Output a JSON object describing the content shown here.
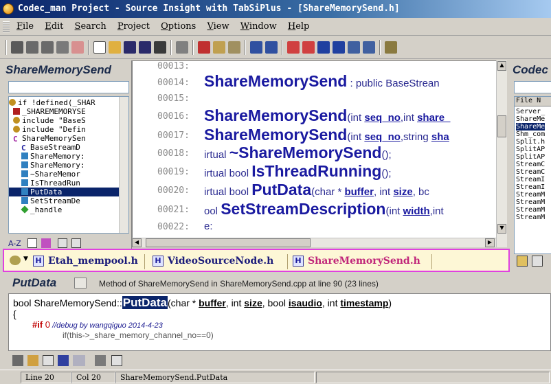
{
  "window": {
    "title": "Codec_man Project - Source Insight with TabSiPlus - [ShareMemorySend.h]"
  },
  "menu": {
    "items": [
      "File",
      "Edit",
      "Search",
      "Project",
      "Options",
      "View",
      "Window",
      "Help"
    ]
  },
  "symbol_panel": {
    "title": "ShareMemorySend",
    "symbols": [
      {
        "label": "if !defined(_SHAR",
        "icon": "preprocessor-icon"
      },
      {
        "label": "_SHAREMEMORYSE",
        "icon": "define-icon"
      },
      {
        "label": "include \"BaseS",
        "icon": "include-icon"
      },
      {
        "label": "include \"Defin",
        "icon": "include-icon"
      },
      {
        "label": "ShareMemorySen",
        "icon": "class-icon"
      },
      {
        "label": "BaseStreamD",
        "icon": "class-icon"
      },
      {
        "label": "ShareMemory:",
        "icon": "method-icon"
      },
      {
        "label": "ShareMemory:",
        "icon": "method-icon"
      },
      {
        "label": "~ShareMemor",
        "icon": "method-icon"
      },
      {
        "label": "IsThreadRun",
        "icon": "method-icon"
      },
      {
        "label": "PutData",
        "icon": "method-icon",
        "selected": true
      },
      {
        "label": "SetStreamDe",
        "icon": "method-icon"
      },
      {
        "label": "_handle",
        "icon": "member-icon"
      }
    ],
    "bottom_label": "A-Z"
  },
  "editor": {
    "line_numbers": [
      "00013:",
      "00014:",
      "00015:",
      "00016:",
      "00017:",
      "00018:",
      "00019:",
      "00020:",
      "00021:",
      "00022:"
    ],
    "lines": {
      "l14_name": "ShareMemorySend",
      "l14_rest": " : public BaseStrean",
      "l16_name": "ShareMemorySend",
      "l16_p1": "(int ",
      "l16_a1": "seq_no",
      "l16_p2": ",int ",
      "l16_a2": "share_",
      "l17_name": "ShareMemorySend",
      "l17_p1": "(int ",
      "l17_a1": "seq_no",
      "l17_p2": ",string ",
      "l17_a2": "sha",
      "l18_pre": "irtual ",
      "l18_name": "~ShareMemorySend",
      "l18_post": "();",
      "l19_pre": "irtual bool ",
      "l19_name": "IsThreadRunning",
      "l19_post": "();",
      "l20_pre": "irtual bool ",
      "l20_name": "PutData",
      "l20_p1": "(char * ",
      "l20_a1": "buffer",
      "l20_p2": ", int ",
      "l20_a2": "size",
      "l20_p3": ", bc",
      "l21_pre": "ool ",
      "l21_name": "SetStreamDescription",
      "l21_p1": "(int ",
      "l21_a1": "width",
      "l21_p2": ",int",
      "l22": "e:"
    }
  },
  "file_panel": {
    "title": "Codec",
    "header": "File N",
    "files": [
      {
        "label": "Server_"
      },
      {
        "label": "ShareMe"
      },
      {
        "label": "ShareMe",
        "selected": true
      },
      {
        "label": "Shm_com"
      },
      {
        "label": "Split.h"
      },
      {
        "label": "SplitAP"
      },
      {
        "label": "SplitAP"
      },
      {
        "label": "StreamC"
      },
      {
        "label": "StreamC"
      },
      {
        "label": "StreamI"
      },
      {
        "label": "StreamI"
      },
      {
        "label": "StreamM"
      },
      {
        "label": "StreamM"
      },
      {
        "label": "StreamM"
      },
      {
        "label": "StreamM"
      }
    ]
  },
  "tabs": [
    {
      "label": "Etah_mempool.h",
      "icon": "H"
    },
    {
      "label": "VideoSourceNode.h",
      "icon": "H"
    },
    {
      "label": "ShareMemorySend.h",
      "icon": "H",
      "active": true
    }
  ],
  "context": {
    "symbol": "PutData",
    "description": "Method of ShareMemorySend in ShareMemorySend.cpp at line 90 (23 lines)",
    "line1_pre": "bool ShareMemorySend::",
    "line1_name": "PutData",
    "line1_p1": "(char * ",
    "line1_a1": "buffer",
    "line1_p2": ", int ",
    "line1_a2": "size",
    "line1_p3": ", bool ",
    "line1_a3": "isaudio",
    "line1_p4": ", int ",
    "line1_a4": "timestamp",
    "line1_p5": ")",
    "line2": "{",
    "line3_kw": "#if",
    "line3_num": " 0",
    "line3_cmt": "  //debug by wangqiguo 2014-4-23",
    "line4": "if(this->_share_memory_channel_no==0)"
  },
  "status": {
    "line": "Line 20",
    "col": "Col 20",
    "symbol": "ShareMemorySend.PutData"
  }
}
